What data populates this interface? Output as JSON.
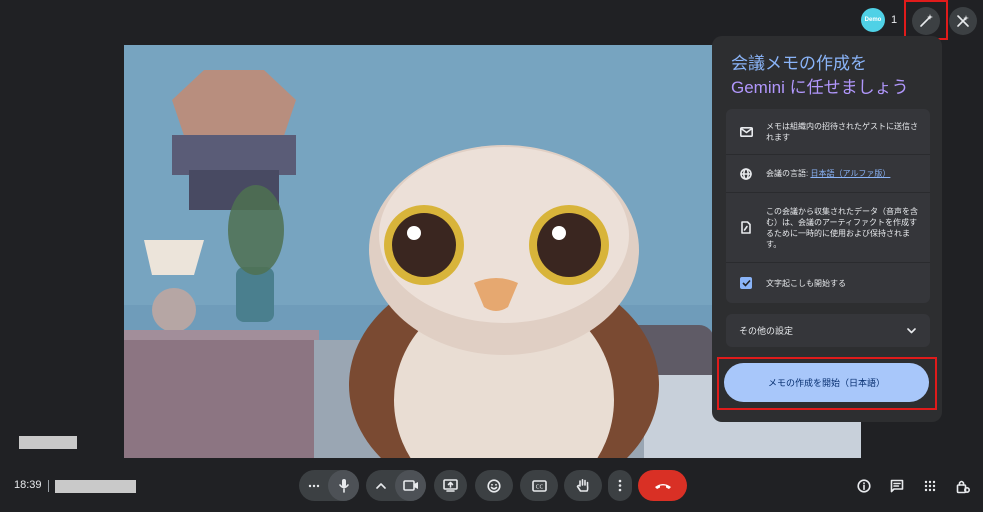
{
  "participants": {
    "avatar_label": "Demo",
    "count": "1"
  },
  "gemini_panel": {
    "title_line1": "会議メモの作成を",
    "title_line2_brand": "Gemini",
    "title_line2_rest": " に任せましょう",
    "items": [
      {
        "icon": "mail-icon",
        "text": "メモは組織内の招待されたゲストに送信されます"
      },
      {
        "icon": "globe-icon",
        "prefix": "会議の言語: ",
        "link": "日本語（アルファ版）"
      },
      {
        "icon": "document-icon",
        "text": "この会議から収集されたデータ（音声を含む）は、会議のアーティファクトを作成するために一時的に使用および保持されます。"
      },
      {
        "icon": "checkbox-icon",
        "text": "文字起こしも開始する",
        "checked": true
      }
    ],
    "other_settings_label": "その他の設定",
    "start_button_label": "メモの作成を開始（日本語）"
  },
  "bottom_bar": {
    "time": "18:39",
    "controls": [
      "more-options-icon",
      "microphone-icon",
      "chevron-up-icon",
      "camera-icon",
      "present-screen-icon",
      "emoji-icon",
      "captions-icon",
      "raise-hand-icon",
      "more-vert-icon",
      "hang-up-icon"
    ],
    "right_icons": [
      "info-icon",
      "chat-icon",
      "activities-icon",
      "host-controls-icon"
    ]
  },
  "colors": {
    "accent": "#8ab4f8",
    "button_bg": "#a8c7fa",
    "hangup": "#d93025",
    "highlight": "#e01b1b",
    "background": "#202124"
  }
}
